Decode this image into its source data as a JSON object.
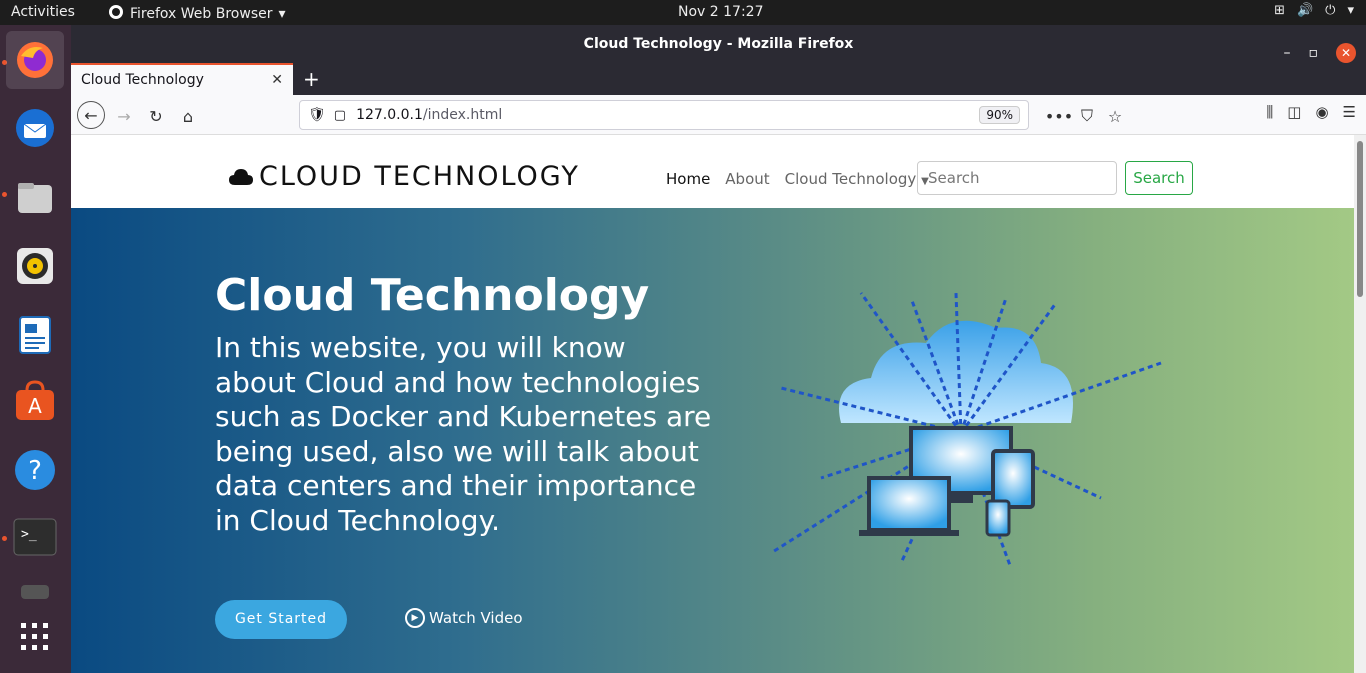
{
  "topbar": {
    "activities": "Activities",
    "app_name": "Firefox Web Browser",
    "clock": "Nov 2  17:27"
  },
  "window": {
    "title": "Cloud Technology - Mozilla Firefox"
  },
  "tab": {
    "title": "Cloud Technology"
  },
  "urlbar": {
    "host": "127.0.0.1",
    "path": "/index.html",
    "zoom": "90%"
  },
  "site": {
    "brand": "CLOUD TECHNOLOGY",
    "nav": {
      "home": "Home",
      "about": "About",
      "cloud": "Cloud Technology"
    },
    "search_placeholder": "Search",
    "search_button": "Search"
  },
  "hero": {
    "title": "Cloud Technology",
    "text": "In this website, you will know about Cloud and how technologies such as Docker and Kubernetes are being used, also we will talk about data centers and their importance in Cloud Technology.",
    "start_button": "Get Started",
    "watch_video": "Watch Video"
  },
  "dock": [
    "firefox-icon",
    "thunderbird-icon",
    "files-icon",
    "rhythmbox-icon",
    "writer-icon",
    "software-icon",
    "help-icon",
    "terminal-icon",
    "removable-drive-icon",
    "show-apps-icon"
  ],
  "colors": {
    "accent": "#e9542e",
    "search_green": "#28a745",
    "button_blue": "#3ba7e0"
  }
}
